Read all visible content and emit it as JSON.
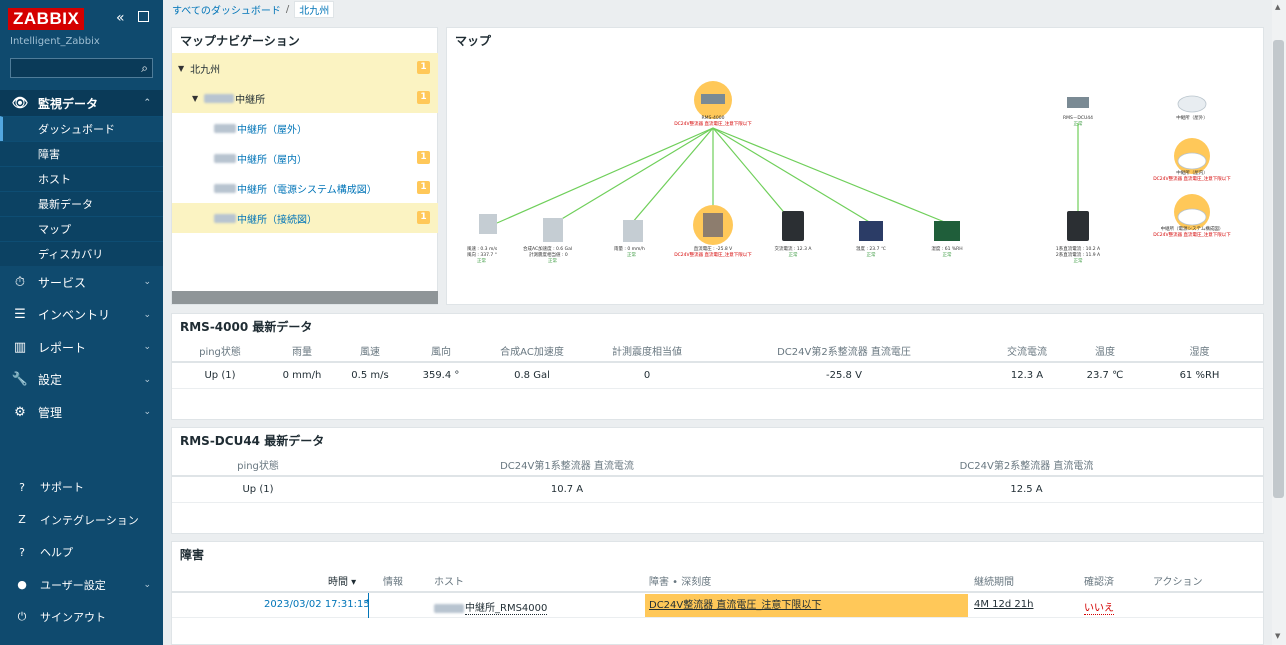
{
  "sidebar": {
    "logo": "ZABBIX",
    "org": "Intelligent_Zabbix",
    "search_placeholder": "",
    "menu": [
      {
        "label": "監視データ",
        "icon": "eye-icon",
        "glyph": "👁",
        "active": true
      },
      {
        "label": "サービス",
        "icon": "clock-icon",
        "glyph": "⏱"
      },
      {
        "label": "インベントリ",
        "icon": "list-icon",
        "glyph": "☰"
      },
      {
        "label": "レポート",
        "icon": "chart-icon",
        "glyph": "▥"
      },
      {
        "label": "設定",
        "icon": "wrench-icon",
        "glyph": "🔧"
      },
      {
        "label": "管理",
        "icon": "gear-icon",
        "glyph": "⚙"
      }
    ],
    "submenu": [
      "ダッシュボード",
      "障害",
      "ホスト",
      "最新データ",
      "マップ",
      "ディスカバリ"
    ],
    "bottom": [
      {
        "label": "サポート",
        "glyph": "?"
      },
      {
        "label": "インテグレーション",
        "glyph": "Z"
      },
      {
        "label": "ヘルプ",
        "glyph": "?"
      },
      {
        "label": "ユーザー設定",
        "glyph": "●"
      },
      {
        "label": "サインアウト",
        "glyph": "⏻"
      }
    ]
  },
  "breadcrumb": {
    "root": "すべてのダッシュボード",
    "current": "北九州"
  },
  "mapnav": {
    "title": "マップナビゲーション",
    "items": [
      {
        "label": "北九州",
        "badge": "1"
      },
      {
        "label": "中継所",
        "badge": "1"
      },
      {
        "label": "中継所（屋外）",
        "badge": ""
      },
      {
        "label": "中継所（屋内）",
        "badge": "1"
      },
      {
        "label": "中継所（電源システム構成図）",
        "badge": "1"
      },
      {
        "label": "中継所（接続図）",
        "badge": "1"
      }
    ]
  },
  "map": {
    "title": "マップ",
    "center_name": "RMS-4000",
    "center_problem": "DC24V整流器 直流電圧_注意下限以下",
    "dcu_name": "RMS－DCU44",
    "nodes": [
      {
        "l1": "風速 : 0.3 m/s",
        "l2": "風向 : 337.7 °",
        "st": "正常"
      },
      {
        "l1": "合成AC加速度 : 0.6 Gal",
        "l2": "計測震度相当値 : 0",
        "st": "正常"
      },
      {
        "l1": "雨量 : 0 mm/h",
        "l2": "",
        "st": "正常"
      },
      {
        "l1": "直流電圧 : -25.8 V",
        "l2": "DC24V整流器 直流電圧_注意下限以下",
        "st": ""
      },
      {
        "l1": "交流電流 : 12.3 A",
        "l2": "",
        "st": "正常"
      },
      {
        "l1": "温度 : 23.7 ℃",
        "l2": "",
        "st": "正常"
      },
      {
        "l1": "湿度 : 61 %RH",
        "l2": "",
        "st": "正常"
      },
      {
        "l1": "1系直流電流 : 10.2 A",
        "l2": "2系直流電流 : 11.9 A",
        "st": "正常"
      }
    ],
    "right_maps": [
      {
        "name": "中継所（屋外）",
        "problem": ""
      },
      {
        "name": "中継所（屋内）",
        "problem": "DC24V整流器 直流電圧_注意下限以下"
      },
      {
        "name": "中継所（電源システム構成図）",
        "problem": "DC24V整流器 直流電圧_注意下限以下"
      }
    ]
  },
  "rms4000": {
    "title": "RMS-4000 最新データ",
    "headers": [
      "ping状態",
      "雨量",
      "風速",
      "風向",
      "合成AC加速度",
      "計測震度相当値",
      "DC24V第2系整流器 直流電圧",
      "交流電流",
      "温度",
      "湿度"
    ],
    "values": [
      "Up (1)",
      "0 mm/h",
      "0.5 m/s",
      "359.4 °",
      "0.8 Gal",
      "0",
      "-25.8 V",
      "12.3 A",
      "23.7 ℃",
      "61 %RH"
    ]
  },
  "dcu44": {
    "title": "RMS-DCU44 最新データ",
    "headers": [
      "ping状態",
      "DC24V第1系整流器 直流電流",
      "DC24V第2系整流器 直流電流"
    ],
    "values": [
      "Up (1)",
      "10.7 A",
      "12.5 A"
    ]
  },
  "problems": {
    "title": "障害",
    "headers": {
      "time": "時間 ▾",
      "info": "情報",
      "host": "ホスト",
      "problem": "障害 • 深刻度",
      "duration": "継続期間",
      "ack": "確認済",
      "actions": "アクション"
    },
    "row": {
      "time": "2023/03/02 17:31:15",
      "host": "中継所_RMS4000",
      "problem": "DC24V整流器 直流電圧_注意下限以下",
      "duration": "4M 12d 21h",
      "ack": "いいえ"
    },
    "severity_color": "#ffc859"
  },
  "colors": {
    "sidebar": "#0f4a6e",
    "link": "#0275b8",
    "badge": "#ffc859",
    "ok": "#429e47",
    "problem": "#d40000"
  }
}
